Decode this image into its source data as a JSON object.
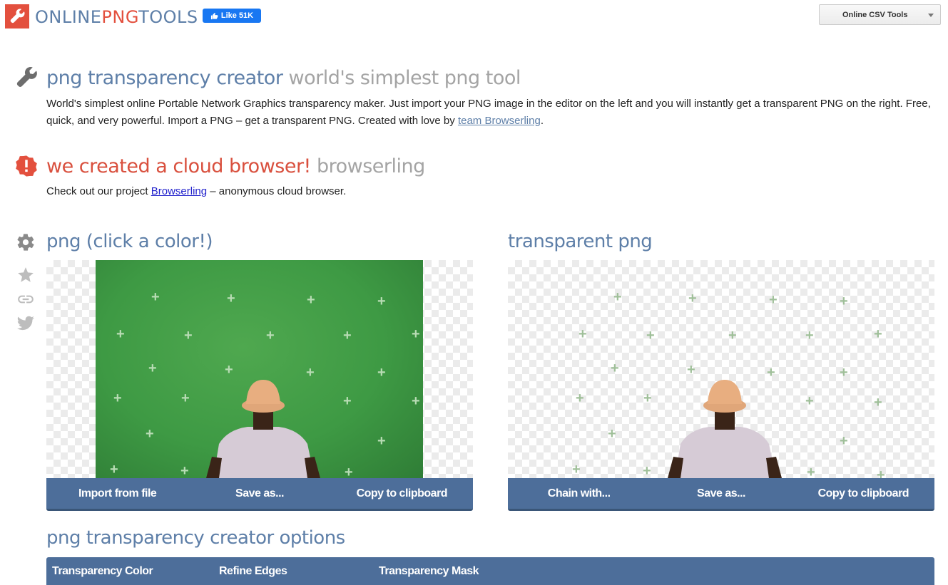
{
  "header": {
    "logo_part1": "ONLINE",
    "logo_part2": "PNG",
    "logo_part3": "TOOLS",
    "fb_like_label": "Like 51K",
    "tools_dropdown": "Online CSV Tools"
  },
  "intro": {
    "title_main": "png transparency creator",
    "title_sub": "world's simplest png tool",
    "desc_before_link": "World's simplest online Portable Network Graphics transparency maker. Just import your PNG image in the editor on the left and you will instantly get a transparent PNG on the right. Free, quick, and very powerful. Import a PNG – get a transparent PNG. Created with love by ",
    "desc_link": "team Browserling",
    "desc_after_link": "."
  },
  "promo": {
    "title_main": "we created a cloud browser!",
    "title_sub": "browserling",
    "desc_before_link": "Check out our project ",
    "desc_link": "Browserling",
    "desc_after_link": " – anonymous cloud browser."
  },
  "input_panel": {
    "title": "png (click a color!)",
    "buttons": [
      "Import from file",
      "Save as...",
      "Copy to clipboard"
    ]
  },
  "output_panel": {
    "title": "transparent png",
    "buttons": [
      "Chain with...",
      "Save as...",
      "Copy to clipboard"
    ]
  },
  "options": {
    "title": "png transparency creator options",
    "tabs": [
      "Transparency Color",
      "Refine Edges",
      "Transparency Mask"
    ]
  },
  "colors": {
    "brand_blue": "#5e7fa8",
    "brand_red": "#e3503e",
    "button_bar": "#4d6e9a",
    "green_screen": "#3e9a44"
  }
}
